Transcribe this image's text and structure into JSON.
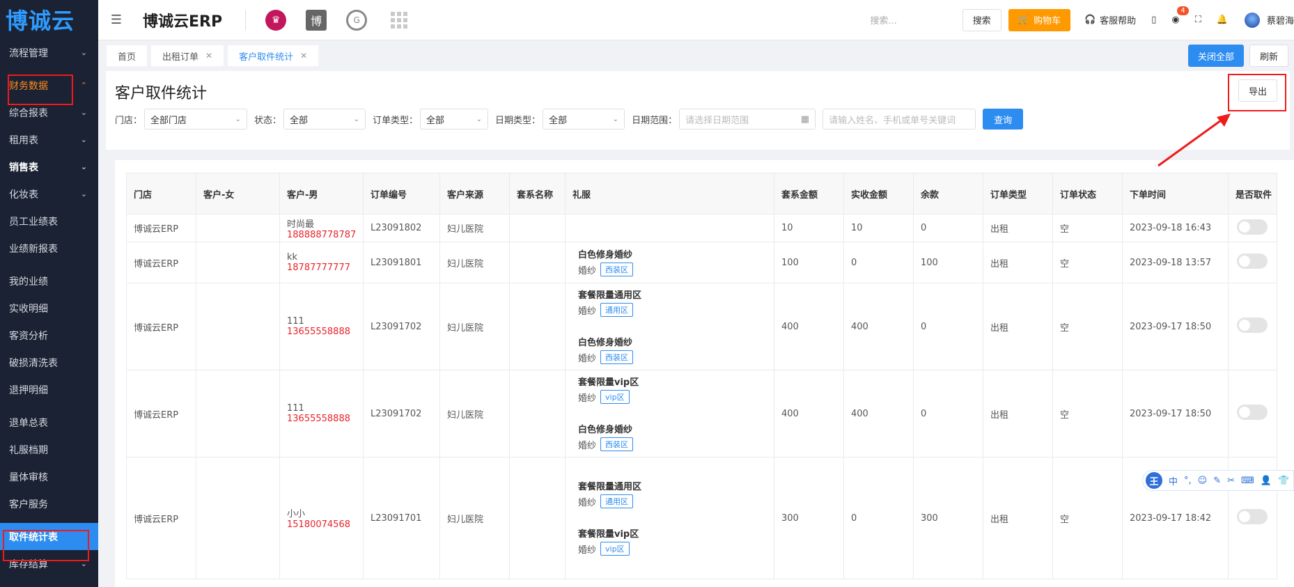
{
  "sidebar": {
    "logo": "博诚云",
    "items": [
      {
        "label": "流程管理",
        "chev": "⌄"
      },
      {
        "label": "财务数据",
        "chev": "⌃"
      },
      {
        "label": "综合报表",
        "chev": "⌄"
      },
      {
        "label": "租用表",
        "chev": "⌄"
      },
      {
        "label": "销售表",
        "chev": "⌄"
      },
      {
        "label": "化妆表",
        "chev": "⌄"
      },
      {
        "label": "员工业绩表"
      },
      {
        "label": "业绩新报表"
      },
      {
        "label": "我的业绩"
      },
      {
        "label": "实收明细"
      },
      {
        "label": "客资分析"
      },
      {
        "label": "破损清洗表"
      },
      {
        "label": "退押明细"
      },
      {
        "label": "退单总表"
      },
      {
        "label": "礼服档期"
      },
      {
        "label": "量体审核"
      },
      {
        "label": "客户服务"
      },
      {
        "label": "取件统计表"
      },
      {
        "label": "库存结算",
        "chev": "⌄"
      }
    ]
  },
  "topbar": {
    "brand": "博诚云ERP",
    "search_placeholder": "搜索...",
    "search_button": "搜索",
    "cart_button": "购物车",
    "help": "客服帮助",
    "badge_count": "4",
    "user": "蔡碧海"
  },
  "tabs": {
    "items": [
      "首页",
      "出租订单",
      "客户取件统计"
    ],
    "close_all": "关闭全部",
    "refresh": "刷新"
  },
  "page": {
    "title": "客户取件统计",
    "export": "导出",
    "filters": {
      "store_label": "门店：",
      "store_value": "全部门店",
      "status_label": "状态：",
      "status_value": "全部",
      "order_type_label": "订单类型：",
      "order_type_value": "全部",
      "date_type_label": "日期类型：",
      "date_type_value": "全部",
      "date_range_label": "日期范围：",
      "date_range_placeholder": "请选择日期范围",
      "keyword_placeholder": "请输入姓名、手机或单号关键词",
      "query": "查询"
    }
  },
  "table": {
    "headers": [
      "门店",
      "客户-女",
      "客户-男",
      "订单编号",
      "客户来源",
      "套系名称",
      "礼服",
      "套系金额",
      "实收金额",
      "余款",
      "订单类型",
      "订单状态",
      "下单时间",
      "是否取件"
    ],
    "rows": [
      {
        "store": "博诚云ERP",
        "female": "",
        "male_name": "时尚最",
        "male_phone": "188888778787",
        "order_no": "L23091802",
        "source": "妇儿医院",
        "package": "",
        "gowns": [],
        "pkg_amount": "10",
        "paid": "10",
        "balance": "0",
        "order_type": "出租",
        "status": "空",
        "time": "2023-09-18 16:43"
      },
      {
        "store": "博诚云ERP",
        "female": "",
        "male_name": "kk",
        "male_phone": "18787777777",
        "order_no": "L23091801",
        "source": "妇儿医院",
        "package": "",
        "gowns": [
          {
            "name": "白色修身婚纱",
            "kind": "婚纱",
            "zone": "西装区"
          }
        ],
        "pkg_amount": "100",
        "paid": "0",
        "balance": "100",
        "order_type": "出租",
        "status": "空",
        "time": "2023-09-18 13:57"
      },
      {
        "store": "博诚云ERP",
        "female": "",
        "male_name": "111",
        "male_phone": "13655558888",
        "order_no": "L23091702",
        "source": "妇儿医院",
        "package": "",
        "gowns": [
          {
            "name": "套餐限量通用区",
            "kind": "婚纱",
            "zone": "通用区"
          },
          {
            "name": "白色修身婚纱",
            "kind": "婚纱",
            "zone": "西装区"
          }
        ],
        "pkg_amount": "400",
        "paid": "400",
        "balance": "0",
        "order_type": "出租",
        "status": "空",
        "time": "2023-09-17 18:50"
      },
      {
        "store": "博诚云ERP",
        "female": "",
        "male_name": "111",
        "male_phone": "13655558888",
        "order_no": "L23091702",
        "source": "妇儿医院",
        "package": "",
        "gowns": [
          {
            "name": "套餐限量vip区",
            "kind": "婚纱",
            "zone": "vip区"
          },
          {
            "name": "白色修身婚纱",
            "kind": "婚纱",
            "zone": "西装区"
          }
        ],
        "pkg_amount": "400",
        "paid": "400",
        "balance": "0",
        "order_type": "出租",
        "status": "空",
        "time": "2023-09-17 18:50"
      },
      {
        "store": "博诚云ERP",
        "female": "",
        "male_name": "小小",
        "male_phone": "15180074568",
        "order_no": "L23091701",
        "source": "妇儿医院",
        "package": "",
        "gowns": [
          {
            "name": "套餐限量通用区",
            "kind": "婚纱",
            "zone": "通用区"
          },
          {
            "name": "套餐限量vip区",
            "kind": "婚纱",
            "zone": "vip区"
          }
        ],
        "pkg_amount": "300",
        "paid": "0",
        "balance": "300",
        "order_type": "出租",
        "status": "空",
        "time": "2023-09-17 18:42"
      }
    ]
  },
  "ime_toolbar": {
    "logo": "王",
    "lang": "中"
  },
  "colors": {
    "accent": "#2d8cf0",
    "orange": "#ff9900",
    "annotation_red": "#f01a1a",
    "phone_red": "#e8232a"
  }
}
